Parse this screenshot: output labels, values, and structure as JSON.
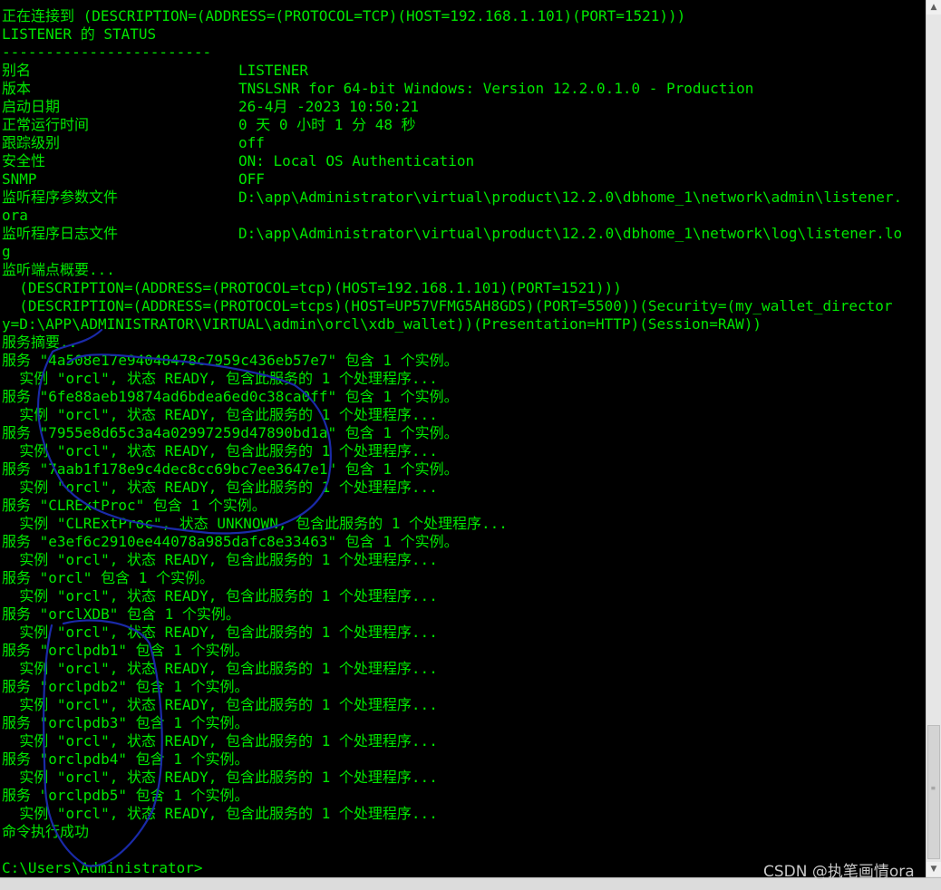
{
  "console": {
    "header": [
      "正在连接到 (DESCRIPTION=(ADDRESS=(PROTOCOL=TCP)(HOST=192.168.1.101)(PORT=1521)))",
      "LISTENER 的 STATUS",
      "------------------------"
    ],
    "status_rows": [
      {
        "key": "别名",
        "value": "LISTENER"
      },
      {
        "key": "版本",
        "value": "TNSLSNR for 64-bit Windows: Version 12.2.0.1.0 - Production"
      },
      {
        "key": "启动日期",
        "value": "26-4月 -2023 10:50:21"
      },
      {
        "key": "正常运行时间",
        "value": "0 天 0 小时 1 分 48 秒"
      },
      {
        "key": "跟踪级别",
        "value": "off"
      },
      {
        "key": "安全性",
        "value": "ON: Local OS Authentication"
      },
      {
        "key": "SNMP",
        "value": "OFF"
      },
      {
        "key": "监听程序参数文件",
        "value": "D:\\app\\Administrator\\virtual\\product\\12.2.0\\dbhome_1\\network\\admin\\listener."
      },
      {
        "key": "ora",
        "value": ""
      },
      {
        "key": "监听程序日志文件",
        "value": "D:\\app\\Administrator\\virtual\\product\\12.2.0\\dbhome_1\\network\\log\\listener.lo"
      },
      {
        "key": "g",
        "value": ""
      }
    ],
    "endpoints": [
      "监听端点概要...",
      "  (DESCRIPTION=(ADDRESS=(PROTOCOL=tcp)(HOST=192.168.1.101)(PORT=1521)))",
      "  (DESCRIPTION=(ADDRESS=(PROTOCOL=tcps)(HOST=UP57VFMG5AH8GDS)(PORT=5500))(Security=(my_wallet_director",
      "y=D:\\APP\\ADMINISTRATOR\\VIRTUAL\\admin\\orcl\\xdb_wallet))(Presentation=HTTP)(Session=RAW))"
    ],
    "services": [
      "服务摘要..",
      "服务 \"4a508e17e94048478c7959c436eb57e7\" 包含 1 个实例。",
      "  实例 \"orcl\", 状态 READY, 包含此服务的 1 个处理程序...",
      "服务 \"6fe88aeb19874ad6bdea6ed0c38ca0ff\" 包含 1 个实例。",
      "  实例 \"orcl\", 状态 READY, 包含此服务的 1 个处理程序...",
      "服务 \"7955e8d65c3a4a02997259d47890bd1a\" 包含 1 个实例。",
      "  实例 \"orcl\", 状态 READY, 包含此服务的 1 个处理程序...",
      "服务 \"7aab1f178e9c4dec8cc69bc7ee3647e1\" 包含 1 个实例。",
      "  实例 \"orcl\", 状态 READY, 包含此服务的 1 个处理程序...",
      "服务 \"CLRExtProc\" 包含 1 个实例。",
      "  实例 \"CLRExtProc\", 状态 UNKNOWN, 包含此服务的 1 个处理程序...",
      "服务 \"e3ef6c2910ee44078a985dafc8e33463\" 包含 1 个实例。",
      "  实例 \"orcl\", 状态 READY, 包含此服务的 1 个处理程序...",
      "服务 \"orcl\" 包含 1 个实例。",
      "  实例 \"orcl\", 状态 READY, 包含此服务的 1 个处理程序...",
      "服务 \"orclXDB\" 包含 1 个实例。",
      "  实例 \"orcl\", 状态 READY, 包含此服务的 1 个处理程序...",
      "服务 \"orclpdb1\" 包含 1 个实例。",
      "  实例 \"orcl\", 状态 READY, 包含此服务的 1 个处理程序...",
      "服务 \"orclpdb2\" 包含 1 个实例。",
      "  实例 \"orcl\", 状态 READY, 包含此服务的 1 个处理程序...",
      "服务 \"orclpdb3\" 包含 1 个实例。",
      "  实例 \"orcl\", 状态 READY, 包含此服务的 1 个处理程序...",
      "服务 \"orclpdb4\" 包含 1 个实例。",
      "  实例 \"orcl\", 状态 READY, 包含此服务的 1 个处理程序...",
      "服务 \"orclpdb5\" 包含 1 个实例。",
      "  实例 \"orcl\", 状态 READY, 包含此服务的 1 个处理程序...",
      "命令执行成功"
    ],
    "prompt": "C:\\Users\\Administrator>"
  },
  "watermark": "CSDN @执笔画情ora",
  "colors": {
    "background": "#000000",
    "text": "#00e600",
    "annotation_ink": "#1a2aa8",
    "watermark": "#c8c8c8"
  },
  "icons": {
    "scroll_up": "▲",
    "scroll_down": "▼"
  }
}
